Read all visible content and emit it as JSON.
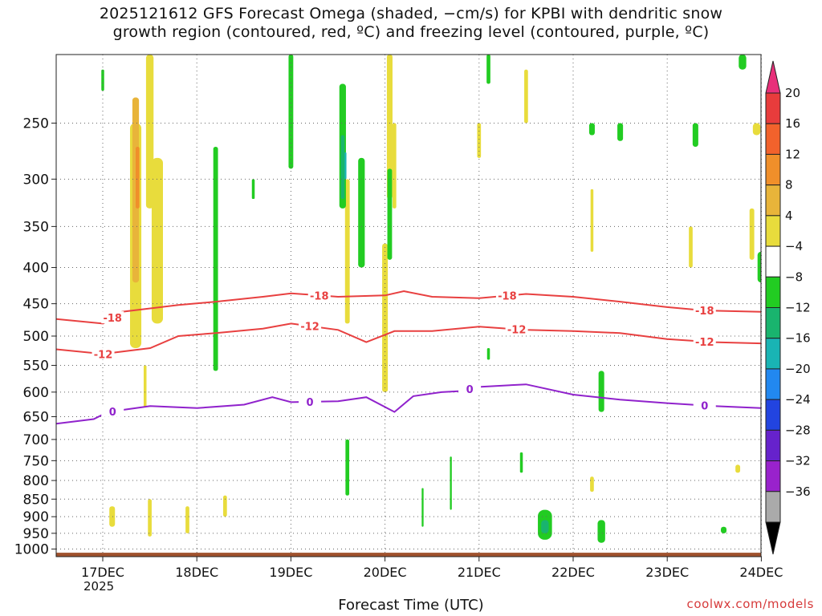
{
  "title": {
    "line1": "2025121612 GFS Forecast Omega (shaded, −cm/s) for KPBI with dendritic snow",
    "line2": "growth region (contoured, red, ºC) and freezing level (contoured, purple, ºC)"
  },
  "credit": "coolwx.com/models",
  "chart_data": {
    "type": "heatmap",
    "xlabel": "Forecast Time (UTC)",
    "x_ticks": [
      "17DEC",
      "18DEC",
      "19DEC",
      "20DEC",
      "21DEC",
      "22DEC",
      "23DEC",
      "24DEC"
    ],
    "x_year_label": "2025",
    "xlim": [
      "2025-12-16T12",
      "2025-12-24T00"
    ],
    "y_ticks": [
      250,
      300,
      350,
      400,
      450,
      500,
      550,
      600,
      650,
      700,
      750,
      800,
      850,
      900,
      950,
      1000
    ],
    "ylim": [
      200,
      1025
    ],
    "y_scale": "log",
    "grid": true,
    "colorbar": {
      "labels": [
        "20",
        "16",
        "12",
        "8",
        "4",
        "−4",
        "−8",
        "−12",
        "−16",
        "−20",
        "−24",
        "−28",
        "−32",
        "−36"
      ],
      "bins": [
        {
          "color": "#e83c3c"
        },
        {
          "color": "#f2622c"
        },
        {
          "color": "#f08f2a"
        },
        {
          "color": "#e8b43a"
        },
        {
          "color": "#e8dc3c"
        },
        {
          "color": "#ffffff"
        },
        {
          "color": "#22cc22"
        },
        {
          "color": "#19b46e"
        },
        {
          "color": "#19b4b4"
        },
        {
          "color": "#2288f0"
        },
        {
          "color": "#2244e0"
        },
        {
          "color": "#6622cc"
        },
        {
          "color": "#9922cc"
        },
        {
          "color": "#aaaaaa"
        }
      ],
      "top_arrow_color": "#e8307a",
      "bottom_arrow_color": "#000000"
    },
    "contours": [
      {
        "name": "-18",
        "color": "#e84040",
        "label_text": "-18",
        "points": [
          [
            0,
            473
          ],
          [
            0.5,
            480
          ],
          [
            0.7,
            462
          ],
          [
            1.3,
            452
          ],
          [
            1.7,
            447
          ],
          [
            2.2,
            440
          ],
          [
            2.5,
            435
          ],
          [
            3.0,
            440
          ],
          [
            3.5,
            438
          ],
          [
            3.7,
            432
          ],
          [
            4.0,
            440
          ],
          [
            4.5,
            442
          ],
          [
            5.0,
            436
          ],
          [
            5.5,
            440
          ],
          [
            6.0,
            447
          ],
          [
            6.5,
            455
          ],
          [
            6.9,
            460
          ],
          [
            7.5,
            462
          ]
        ],
        "label_at": [
          0.6,
          2.8,
          4.8,
          6.9
        ]
      },
      {
        "name": "-12",
        "color": "#e84040",
        "label_text": "-12",
        "points": [
          [
            0,
            522
          ],
          [
            0.5,
            530
          ],
          [
            1.0,
            520
          ],
          [
            1.3,
            500
          ],
          [
            1.7,
            495
          ],
          [
            2.2,
            488
          ],
          [
            2.5,
            480
          ],
          [
            3.0,
            490
          ],
          [
            3.3,
            510
          ],
          [
            3.6,
            492
          ],
          [
            4.0,
            492
          ],
          [
            4.5,
            485
          ],
          [
            5.0,
            490
          ],
          [
            5.5,
            492
          ],
          [
            6.0,
            495
          ],
          [
            6.5,
            505
          ],
          [
            7.0,
            510
          ],
          [
            7.5,
            512
          ]
        ],
        "label_at": [
          0.5,
          2.7,
          4.9,
          6.9
        ]
      },
      {
        "name": "0",
        "color": "#9022cc",
        "label_text": "0",
        "points": [
          [
            0,
            665
          ],
          [
            0.4,
            655
          ],
          [
            0.55,
            640
          ],
          [
            1.0,
            628
          ],
          [
            1.5,
            632
          ],
          [
            2.0,
            625
          ],
          [
            2.3,
            610
          ],
          [
            2.5,
            620
          ],
          [
            3.0,
            618
          ],
          [
            3.3,
            610
          ],
          [
            3.6,
            640
          ],
          [
            3.8,
            608
          ],
          [
            4.1,
            600
          ],
          [
            4.3,
            598
          ],
          [
            4.5,
            590
          ],
          [
            5.0,
            585
          ],
          [
            5.5,
            605
          ],
          [
            6.0,
            615
          ],
          [
            6.5,
            622
          ],
          [
            7.0,
            628
          ],
          [
            7.5,
            632
          ]
        ],
        "label_at": [
          0.6,
          2.7,
          4.4,
          6.9
        ]
      }
    ],
    "omega_regions": [
      {
        "bin": 4,
        "t": 0.35,
        "p": [
          250,
          520
        ],
        "w": 0.12
      },
      {
        "bin": 3,
        "t": 0.35,
        "p": [
          230,
          420
        ],
        "w": 0.07
      },
      {
        "bin": 2,
        "t": 0.37,
        "p": [
          270,
          330
        ],
        "w": 0.04
      },
      {
        "bin": 4,
        "t": 0.58,
        "p": [
          280,
          480
        ],
        "w": 0.12
      },
      {
        "bin": 4,
        "t": 0.5,
        "p": [
          200,
          330
        ],
        "w": 0.08
      },
      {
        "bin": 4,
        "t": 0.45,
        "p": [
          550,
          630
        ],
        "w": 0.03
      },
      {
        "bin": 4,
        "t": 0.1,
        "p": [
          870,
          930
        ],
        "w": 0.06
      },
      {
        "bin": 4,
        "t": 0.5,
        "p": [
          850,
          960
        ],
        "w": 0.04
      },
      {
        "bin": 4,
        "t": 0.9,
        "p": [
          870,
          950
        ],
        "w": 0.04
      },
      {
        "bin": 4,
        "t": 1.3,
        "p": [
          840,
          900
        ],
        "w": 0.04
      },
      {
        "bin": 4,
        "t": 2.6,
        "p": [
          300,
          480
        ],
        "w": 0.05
      },
      {
        "bin": 4,
        "t": 3.0,
        "p": [
          370,
          600
        ],
        "w": 0.06
      },
      {
        "bin": 4,
        "t": 3.05,
        "p": [
          200,
          320
        ],
        "w": 0.06
      },
      {
        "bin": 4,
        "t": 3.1,
        "p": [
          250,
          330
        ],
        "w": 0.04
      },
      {
        "bin": 4,
        "t": 4.0,
        "p": [
          250,
          280
        ],
        "w": 0.04
      },
      {
        "bin": 4,
        "t": 4.5,
        "p": [
          210,
          250
        ],
        "w": 0.04
      },
      {
        "bin": 4,
        "t": 5.2,
        "p": [
          310,
          380
        ],
        "w": 0.03
      },
      {
        "bin": 4,
        "t": 6.9,
        "p": [
          330,
          390
        ],
        "w": 0.05
      },
      {
        "bin": 4,
        "t": 6.95,
        "p": [
          250,
          260
        ],
        "w": 0.08
      },
      {
        "bin": 4,
        "t": 7.5,
        "p": [
          290,
          340
        ],
        "w": 0.04
      },
      {
        "bin": 4,
        "t": 6.25,
        "p": [
          350,
          400
        ],
        "w": 0.04
      },
      {
        "bin": 4,
        "t": 6.75,
        "p": [
          760,
          780
        ],
        "w": 0.05
      },
      {
        "bin": 4,
        "t": 5.2,
        "p": [
          790,
          830
        ],
        "w": 0.04
      },
      {
        "bin": 4,
        "t": 7.95,
        "p": [
          430,
          480
        ],
        "w": 0.04
      },
      {
        "bin": 6,
        "t": 1.2,
        "p": [
          270,
          560
        ],
        "w": 0.05
      },
      {
        "bin": 6,
        "t": 2.0,
        "p": [
          200,
          290
        ],
        "w": 0.05
      },
      {
        "bin": 6,
        "t": 2.55,
        "p": [
          220,
          330
        ],
        "w": 0.07
      },
      {
        "bin": 6,
        "t": 2.75,
        "p": [
          280,
          400
        ],
        "w": 0.07
      },
      {
        "bin": 6,
        "t": 3.05,
        "p": [
          290,
          390
        ],
        "w": 0.05
      },
      {
        "bin": 6,
        "t": 4.1,
        "p": [
          200,
          220
        ],
        "w": 0.04
      },
      {
        "bin": 6,
        "t": 1.6,
        "p": [
          300,
          320
        ],
        "w": 0.03
      },
      {
        "bin": 6,
        "t": 2.6,
        "p": [
          700,
          840
        ],
        "w": 0.04
      },
      {
        "bin": 6,
        "t": 3.4,
        "p": [
          820,
          930
        ],
        "w": 0.02
      },
      {
        "bin": 6,
        "t": 3.7,
        "p": [
          740,
          880
        ],
        "w": 0.02
      },
      {
        "bin": 6,
        "t": 4.1,
        "p": [
          520,
          540
        ],
        "w": 0.03
      },
      {
        "bin": 6,
        "t": 4.45,
        "p": [
          730,
          780
        ],
        "w": 0.03
      },
      {
        "bin": 6,
        "t": 4.7,
        "p": [
          880,
          970
        ],
        "w": 0.15
      },
      {
        "bin": 6,
        "t": 5.3,
        "p": [
          560,
          640
        ],
        "w": 0.06
      },
      {
        "bin": 6,
        "t": 5.3,
        "p": [
          910,
          980
        ],
        "w": 0.08
      },
      {
        "bin": 6,
        "t": 5.2,
        "p": [
          250,
          260
        ],
        "w": 0.06
      },
      {
        "bin": 6,
        "t": 5.5,
        "p": [
          250,
          265
        ],
        "w": 0.06
      },
      {
        "bin": 6,
        "t": 6.3,
        "p": [
          250,
          270
        ],
        "w": 0.06
      },
      {
        "bin": 6,
        "t": 6.6,
        "p": [
          930,
          950
        ],
        "w": 0.06
      },
      {
        "bin": 6,
        "t": 7.0,
        "p": [
          380,
          420
        ],
        "w": 0.08
      },
      {
        "bin": 6,
        "t": 7.1,
        "p": [
          480,
          520
        ],
        "w": 0.08
      },
      {
        "bin": 6,
        "t": 7.1,
        "p": [
          560,
          610
        ],
        "w": 0.06
      },
      {
        "bin": 6,
        "t": 7.1,
        "p": [
          890,
          970
        ],
        "w": 0.08
      },
      {
        "bin": 6,
        "t": 7.35,
        "p": [
          850,
          960
        ],
        "w": 0.09
      },
      {
        "bin": 6,
        "t": 6.8,
        "p": [
          200,
          210
        ],
        "w": 0.08
      },
      {
        "bin": 6,
        "t": 7.45,
        "p": [
          200,
          290
        ],
        "w": 0.08
      },
      {
        "bin": 6,
        "t": 7.05,
        "p": [
          220,
          230
        ],
        "w": 0.04
      },
      {
        "bin": 6,
        "t": 0.0,
        "p": [
          210,
          225
        ],
        "w": 0.03
      },
      {
        "bin": 7,
        "t": 2.55,
        "p": [
          260,
          320
        ],
        "w": 0.04
      },
      {
        "bin": 7,
        "t": 4.7,
        "p": [
          910,
          950
        ],
        "w": 0.08
      },
      {
        "bin": 7,
        "t": 7.5,
        "p": [
          200,
          240
        ],
        "w": 0.05
      },
      {
        "bin": 8,
        "t": 2.58,
        "p": [
          275,
          300
        ],
        "w": 0.02
      }
    ],
    "surface_color": "#a0522d"
  }
}
